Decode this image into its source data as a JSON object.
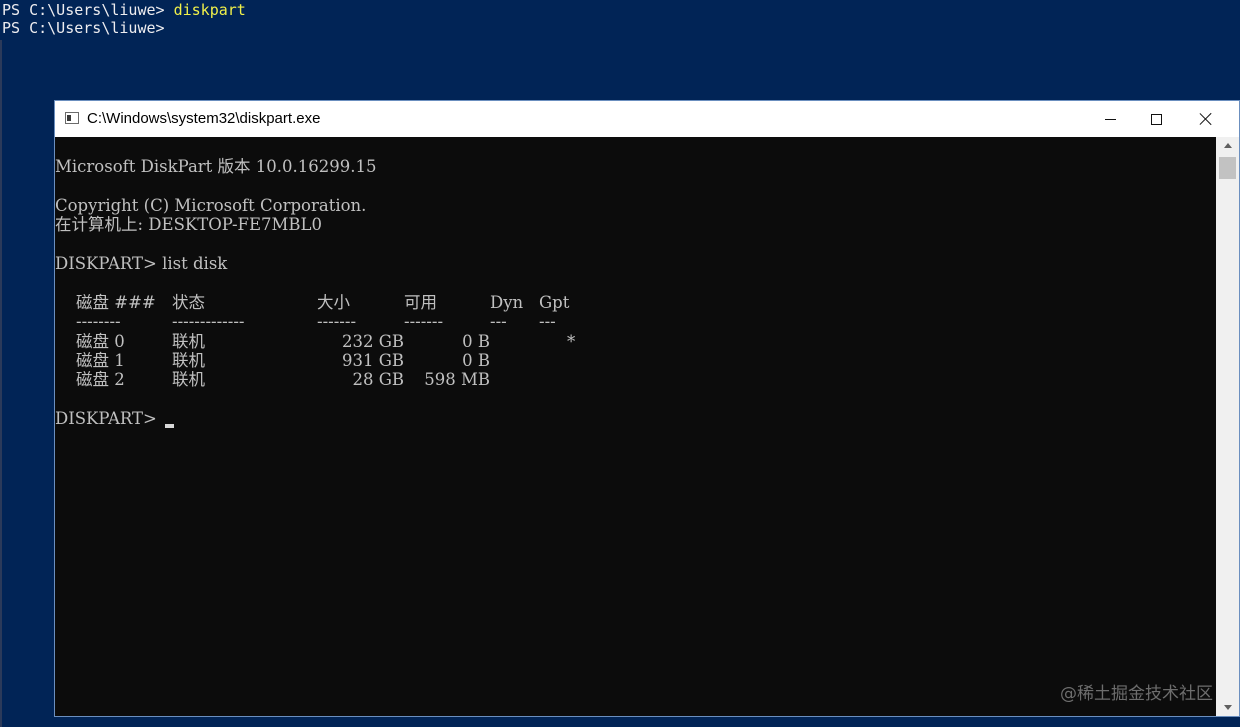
{
  "powershell": {
    "lines": [
      {
        "prompt": "PS C:\\Users\\liuwe> ",
        "command": "diskpart"
      },
      {
        "prompt": "PS C:\\Users\\liuwe>",
        "command": ""
      }
    ]
  },
  "window": {
    "title": "C:\\Windows\\system32\\diskpart.exe",
    "icon": "console-app-icon"
  },
  "console": {
    "version_line": "Microsoft DiskPart 版本 10.0.16299.15",
    "copyright_line": "Copyright (C) Microsoft Corporation.",
    "computer_line": "在计算机上: DESKTOP-FE7MBL0",
    "command_line": "DISKPART> list disk",
    "prompt": "DISKPART>",
    "table": {
      "headers": [
        "磁盘 ###",
        "状态",
        "大小",
        "可用",
        "Dyn",
        "Gpt"
      ],
      "separators": [
        "--------",
        "-------------",
        "-------",
        "-------",
        "---",
        "---"
      ],
      "rows": [
        {
          "disk": "磁盘 0",
          "status": "联机",
          "size": "232 GB",
          "free": "0 B",
          "dyn": "",
          "gpt": "*"
        },
        {
          "disk": "磁盘 1",
          "status": "联机",
          "size": "931 GB",
          "free": "0 B",
          "dyn": "",
          "gpt": ""
        },
        {
          "disk": "磁盘 2",
          "status": "联机",
          "size": "28 GB",
          "free": "598 MB",
          "dyn": "",
          "gpt": ""
        }
      ]
    }
  },
  "watermark": "@稀土掘金技术社区",
  "colors": {
    "powershell_bg": "#012456",
    "powershell_cmd": "#f0f04a",
    "console_bg": "#0c0c0c",
    "console_text": "#c0c0c0"
  }
}
